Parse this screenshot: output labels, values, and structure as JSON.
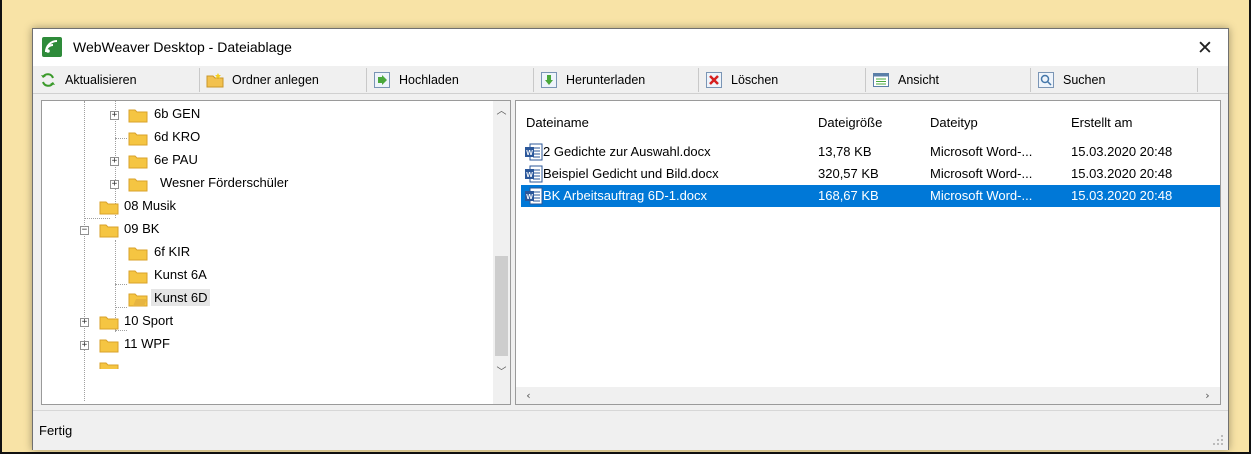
{
  "window": {
    "title": "WebWeaver Desktop - Dateiablage",
    "close_glyph": "✕"
  },
  "toolbar": {
    "items": [
      {
        "label": "Aktualisieren",
        "icon": "refresh-icon"
      },
      {
        "label": "Ordner anlegen",
        "icon": "new-folder-icon"
      },
      {
        "label": "Hochladen",
        "icon": "upload-icon"
      },
      {
        "label": "Herunterladen",
        "icon": "download-icon"
      },
      {
        "label": "Löschen",
        "icon": "delete-icon"
      },
      {
        "label": "Ansicht",
        "icon": "view-icon"
      },
      {
        "label": "Suchen",
        "icon": "search-icon"
      }
    ]
  },
  "tree": {
    "items": [
      {
        "label": "6b GEN",
        "expandable": true
      },
      {
        "label": "6d KRO",
        "expandable": false
      },
      {
        "label": "6e PAU",
        "expandable": true
      },
      {
        "label": "Wesner Förderschüler",
        "expandable": true
      },
      {
        "label": "08 Musik",
        "expandable": false
      },
      {
        "label": "09 BK",
        "expandable": true,
        "expanded": true
      },
      {
        "label": "6f KIR",
        "expandable": false
      },
      {
        "label": "Kunst 6A",
        "expandable": false
      },
      {
        "label": "Kunst 6D",
        "expandable": false,
        "selected": true
      },
      {
        "label": "10 Sport",
        "expandable": true
      },
      {
        "label": "11 WPF",
        "expandable": true
      }
    ]
  },
  "files": {
    "columns": {
      "name": "Dateiname",
      "size": "Dateigröße",
      "type": "Dateityp",
      "created": "Erstellt am"
    },
    "rows": [
      {
        "name": "2 Gedichte zur Auswahl.docx",
        "size": "13,78 KB",
        "type": "Microsoft Word-...",
        "created": "15.03.2020 20:48"
      },
      {
        "name": "Beispiel Gedicht und Bild.docx",
        "size": "320,57 KB",
        "type": "Microsoft Word-...",
        "created": "15.03.2020 20:48"
      },
      {
        "name": "BK Arbeitsauftrag 6D-1.docx",
        "size": "168,67 KB",
        "type": "Microsoft Word-...",
        "created": "15.03.2020 20:48",
        "selected": true
      }
    ]
  },
  "status": {
    "text": "Fertig"
  },
  "colors": {
    "selection": "#0078d7",
    "background_outer": "#f8e3a6",
    "folder": "#f5c542"
  }
}
